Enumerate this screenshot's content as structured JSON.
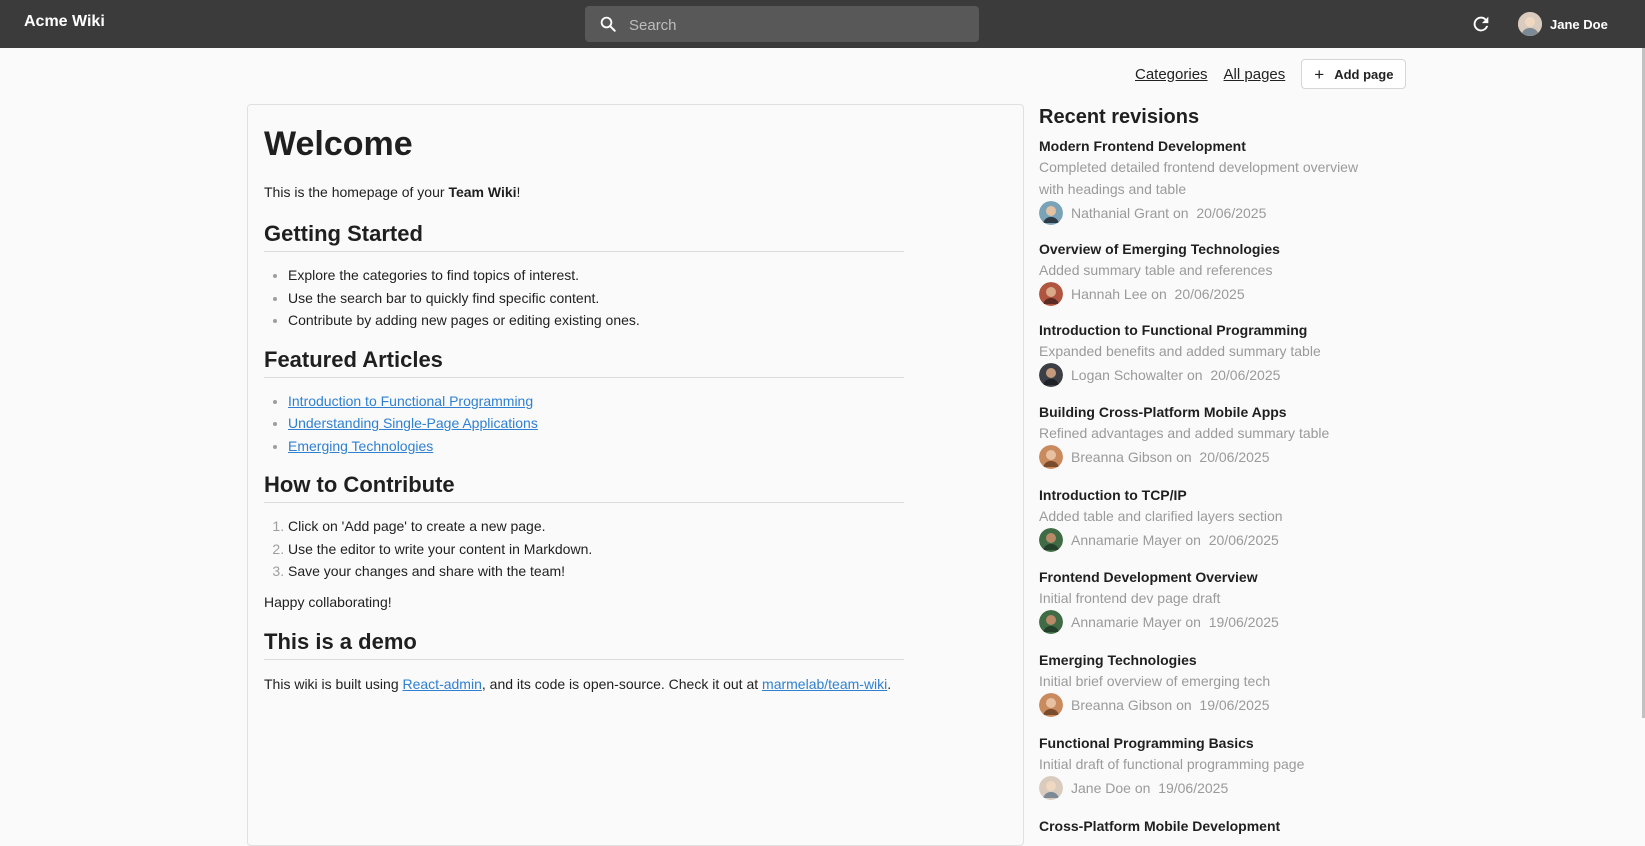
{
  "app": {
    "title": "Acme Wiki"
  },
  "search": {
    "placeholder": "Search"
  },
  "user": {
    "name": "Jane Doe"
  },
  "nav": {
    "categories": "Categories",
    "all_pages": "All pages",
    "add_page": "Add page"
  },
  "page": {
    "title": "Welcome",
    "intro_prefix": "This is the homepage of your ",
    "intro_bold": "Team Wiki",
    "intro_suffix": "!",
    "sections": {
      "getting_started": {
        "heading": "Getting Started",
        "items": [
          "Explore the categories to find topics of interest.",
          "Use the search bar to quickly find specific content.",
          "Contribute by adding new pages or editing existing ones."
        ]
      },
      "featured": {
        "heading": "Featured Articles",
        "items": [
          "Introduction to Functional Programming",
          "Understanding Single-Page Applications",
          "Emerging Technologies"
        ]
      },
      "contribute": {
        "heading": "How to Contribute",
        "items": [
          "Click on 'Add page' to create a new page.",
          "Use the editor to write your content in Markdown.",
          "Save your changes and share with the team!"
        ],
        "outro": "Happy collaborating!"
      },
      "demo": {
        "heading": "This is a demo",
        "text_prefix": "This wiki is built using ",
        "link1": "React-admin",
        "text_middle": ", and its code is open-source. Check it out at ",
        "link2": "marmelab/team-wiki",
        "text_suffix": "."
      }
    }
  },
  "revisions": {
    "heading": "Recent revisions",
    "items": [
      {
        "title": "Modern Frontend Development",
        "desc": "Completed detailed frontend development overview with headings and table",
        "author": "Nathanial Grant on",
        "date": "20/06/2025"
      },
      {
        "title": "Overview of Emerging Technologies",
        "desc": "Added summary table and references",
        "author": "Hannah Lee on",
        "date": "20/06/2025"
      },
      {
        "title": "Introduction to Functional Programming",
        "desc": "Expanded benefits and added summary table",
        "author": "Logan Schowalter on",
        "date": "20/06/2025"
      },
      {
        "title": "Building Cross-Platform Mobile Apps",
        "desc": "Refined advantages and added summary table",
        "author": "Breanna Gibson on",
        "date": "20/06/2025"
      },
      {
        "title": "Introduction to TCP/IP",
        "desc": "Added table and clarified layers section",
        "author": "Annamarie Mayer on",
        "date": "20/06/2025"
      },
      {
        "title": "Frontend Development Overview",
        "desc": "Initial frontend dev page draft",
        "author": "Annamarie Mayer on",
        "date": "19/06/2025"
      },
      {
        "title": "Emerging Technologies",
        "desc": "Initial brief overview of emerging tech",
        "author": "Breanna Gibson on",
        "date": "19/06/2025"
      },
      {
        "title": "Functional Programming Basics",
        "desc": "Initial draft of functional programming page",
        "author": "Jane Doe on",
        "date": "19/06/2025"
      },
      {
        "title": "Cross-Platform Mobile Development",
        "desc": "",
        "author": "",
        "date": ""
      }
    ]
  },
  "colors": {
    "appbar": "#3b3b3b",
    "link": "#2f80d1",
    "muted": "#9a9a9a"
  }
}
